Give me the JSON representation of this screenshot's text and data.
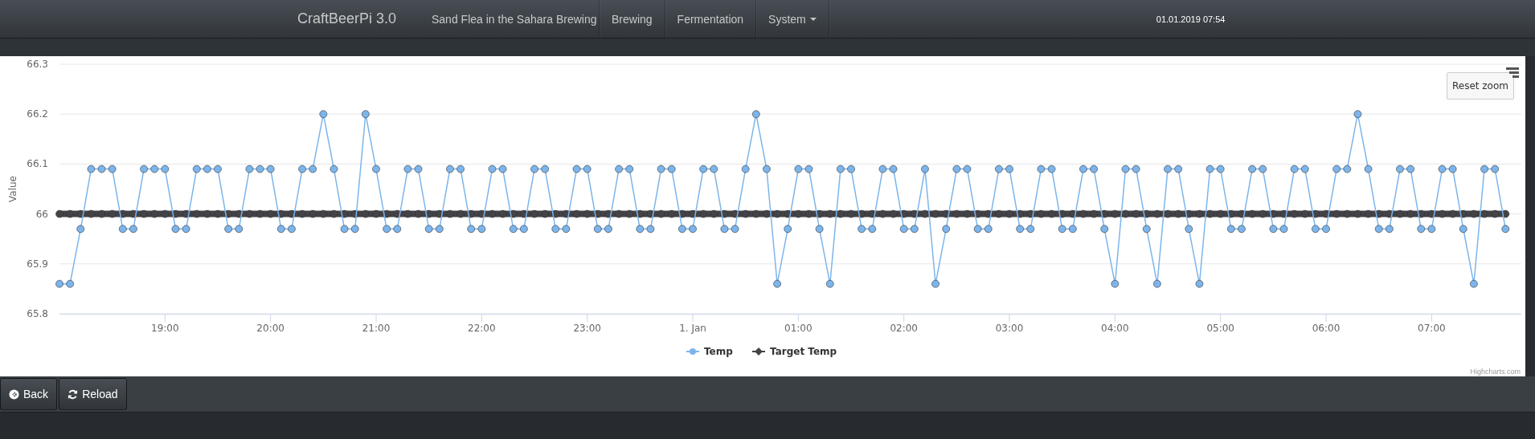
{
  "navbar": {
    "brand": "CraftBeerPi 3.0",
    "items": [
      {
        "label": "Sand Flea in the Sahara Brewing",
        "dropdown": false
      },
      {
        "label": "Brewing",
        "dropdown": false
      },
      {
        "label": "Fermentation",
        "dropdown": false
      },
      {
        "label": "System",
        "dropdown": true
      }
    ],
    "datetime": "01.01.2019 07:54"
  },
  "chart": {
    "reset_zoom": "Reset zoom",
    "credits": "Highcharts.com",
    "chart_data": {
      "type": "line",
      "ylabel": "Value",
      "grid": true,
      "legend": "bottom",
      "x": [
        "2018-12-31 18:00",
        "2018-12-31 18:06",
        "2018-12-31 18:12",
        "2018-12-31 18:18",
        "2018-12-31 18:24",
        "2018-12-31 18:30",
        "2018-12-31 18:36",
        "2018-12-31 18:42",
        "2018-12-31 18:48",
        "2018-12-31 18:54",
        "2018-12-31 19:00",
        "2018-12-31 19:06",
        "2018-12-31 19:12",
        "2018-12-31 19:18",
        "2018-12-31 19:24",
        "2018-12-31 19:30",
        "2018-12-31 19:36",
        "2018-12-31 19:42",
        "2018-12-31 19:48",
        "2018-12-31 19:54",
        "2018-12-31 20:00",
        "2018-12-31 20:06",
        "2018-12-31 20:12",
        "2018-12-31 20:18",
        "2018-12-31 20:24",
        "2018-12-31 20:30",
        "2018-12-31 20:36",
        "2018-12-31 20:42",
        "2018-12-31 20:48",
        "2018-12-31 20:54",
        "2018-12-31 21:00",
        "2018-12-31 21:06",
        "2018-12-31 21:12",
        "2018-12-31 21:18",
        "2018-12-31 21:24",
        "2018-12-31 21:30",
        "2018-12-31 21:36",
        "2018-12-31 21:42",
        "2018-12-31 21:48",
        "2018-12-31 21:54",
        "2018-12-31 22:00",
        "2018-12-31 22:06",
        "2018-12-31 22:12",
        "2018-12-31 22:18",
        "2018-12-31 22:24",
        "2018-12-31 22:30",
        "2018-12-31 22:36",
        "2018-12-31 22:42",
        "2018-12-31 22:48",
        "2018-12-31 22:54",
        "2018-12-31 23:00",
        "2018-12-31 23:06",
        "2018-12-31 23:12",
        "2018-12-31 23:18",
        "2018-12-31 23:24",
        "2018-12-31 23:30",
        "2018-12-31 23:36",
        "2018-12-31 23:42",
        "2018-12-31 23:48",
        "2018-12-31 23:54",
        "2019-01-01 00:00",
        "2019-01-01 00:06",
        "2019-01-01 00:12",
        "2019-01-01 00:18",
        "2019-01-01 00:24",
        "2019-01-01 00:30",
        "2019-01-01 00:36",
        "2019-01-01 00:42",
        "2019-01-01 00:48",
        "2019-01-01 00:54",
        "2019-01-01 01:00",
        "2019-01-01 01:06",
        "2019-01-01 01:12",
        "2019-01-01 01:18",
        "2019-01-01 01:24",
        "2019-01-01 01:30",
        "2019-01-01 01:36",
        "2019-01-01 01:42",
        "2019-01-01 01:48",
        "2019-01-01 01:54",
        "2019-01-01 02:00",
        "2019-01-01 02:06",
        "2019-01-01 02:12",
        "2019-01-01 02:18",
        "2019-01-01 02:24",
        "2019-01-01 02:30",
        "2019-01-01 02:36",
        "2019-01-01 02:42",
        "2019-01-01 02:48",
        "2019-01-01 02:54",
        "2019-01-01 03:00",
        "2019-01-01 03:06",
        "2019-01-01 03:12",
        "2019-01-01 03:18",
        "2019-01-01 03:24",
        "2019-01-01 03:30",
        "2019-01-01 03:36",
        "2019-01-01 03:42",
        "2019-01-01 03:48",
        "2019-01-01 03:54",
        "2019-01-01 04:00",
        "2019-01-01 04:06",
        "2019-01-01 04:12",
        "2019-01-01 04:18",
        "2019-01-01 04:24",
        "2019-01-01 04:30",
        "2019-01-01 04:36",
        "2019-01-01 04:42",
        "2019-01-01 04:48",
        "2019-01-01 04:54",
        "2019-01-01 05:00",
        "2019-01-01 05:06",
        "2019-01-01 05:12",
        "2019-01-01 05:18",
        "2019-01-01 05:24",
        "2019-01-01 05:30",
        "2019-01-01 05:36",
        "2019-01-01 05:42",
        "2019-01-01 05:48",
        "2019-01-01 05:54",
        "2019-01-01 06:00",
        "2019-01-01 06:06",
        "2019-01-01 06:12",
        "2019-01-01 06:18",
        "2019-01-01 06:24",
        "2019-01-01 06:30",
        "2019-01-01 06:36",
        "2019-01-01 06:42",
        "2019-01-01 06:48",
        "2019-01-01 06:54",
        "2019-01-01 07:00",
        "2019-01-01 07:06",
        "2019-01-01 07:12",
        "2019-01-01 07:18",
        "2019-01-01 07:24",
        "2019-01-01 07:30",
        "2019-01-01 07:36",
        "2019-01-01 07:42"
      ],
      "series": [
        {
          "name": "Temp",
          "color": "#7cb5ec",
          "marker": true,
          "values": [
            65.86,
            65.86,
            65.97,
            66.09,
            66.09,
            66.09,
            65.97,
            65.97,
            66.09,
            66.09,
            66.09,
            65.97,
            65.97,
            66.09,
            66.09,
            66.09,
            65.97,
            65.97,
            66.09,
            66.09,
            66.09,
            65.97,
            65.97,
            66.09,
            66.09,
            66.2,
            66.09,
            65.97,
            65.97,
            66.2,
            66.09,
            65.97,
            65.97,
            66.09,
            66.09,
            65.97,
            65.97,
            66.09,
            66.09,
            65.97,
            65.97,
            66.09,
            66.09,
            65.97,
            65.97,
            66.09,
            66.09,
            65.97,
            65.97,
            66.09,
            66.09,
            65.97,
            65.97,
            66.09,
            66.09,
            65.97,
            65.97,
            66.09,
            66.09,
            65.97,
            65.97,
            66.09,
            66.09,
            65.97,
            65.97,
            66.09,
            66.2,
            66.09,
            65.86,
            65.97,
            66.09,
            66.09,
            65.97,
            65.86,
            66.09,
            66.09,
            65.97,
            65.97,
            66.09,
            66.09,
            65.97,
            65.97,
            66.09,
            65.86,
            65.97,
            66.09,
            66.09,
            65.97,
            65.97,
            66.09,
            66.09,
            65.97,
            65.97,
            66.09,
            66.09,
            65.97,
            65.97,
            66.09,
            66.09,
            65.97,
            65.86,
            66.09,
            66.09,
            65.97,
            65.86,
            66.09,
            66.09,
            65.97,
            65.86,
            66.09,
            66.09,
            65.97,
            65.97,
            66.09,
            66.09,
            65.97,
            65.97,
            66.09,
            66.09,
            65.97,
            65.97,
            66.09,
            66.09,
            66.2,
            66.09,
            65.97,
            65.97,
            66.09,
            66.09,
            65.97,
            65.97,
            66.09,
            66.09,
            65.97,
            65.86,
            66.09,
            66.09,
            65.97
          ]
        },
        {
          "name": "Target Temp",
          "color": "#434348",
          "marker": true,
          "values": [
            66,
            66,
            66,
            66,
            66,
            66,
            66,
            66,
            66,
            66,
            66,
            66,
            66,
            66,
            66,
            66,
            66,
            66,
            66,
            66,
            66,
            66,
            66,
            66,
            66,
            66,
            66,
            66,
            66,
            66,
            66,
            66,
            66,
            66,
            66,
            66,
            66,
            66,
            66,
            66,
            66,
            66,
            66,
            66,
            66,
            66,
            66,
            66,
            66,
            66,
            66,
            66,
            66,
            66,
            66,
            66,
            66,
            66,
            66,
            66,
            66,
            66,
            66,
            66,
            66,
            66,
            66,
            66,
            66,
            66,
            66,
            66,
            66,
            66,
            66,
            66,
            66,
            66,
            66,
            66,
            66,
            66,
            66,
            66,
            66,
            66,
            66,
            66,
            66,
            66,
            66,
            66,
            66,
            66,
            66,
            66,
            66,
            66,
            66,
            66,
            66,
            66,
            66,
            66,
            66,
            66,
            66,
            66,
            66,
            66,
            66,
            66,
            66,
            66,
            66,
            66,
            66,
            66,
            66,
            66,
            66,
            66,
            66,
            66,
            66,
            66,
            66,
            66,
            66,
            66,
            66,
            66,
            66,
            66,
            66,
            66,
            66,
            66
          ]
        }
      ],
      "xlim": [
        "2018-12-31 18:00",
        "2019-01-01 07:51"
      ],
      "ylim": [
        65.8,
        66.3
      ],
      "xticks": [
        {
          "value": "2018-12-31 19:00",
          "label": "19:00"
        },
        {
          "value": "2018-12-31 20:00",
          "label": "20:00"
        },
        {
          "value": "2018-12-31 21:00",
          "label": "21:00"
        },
        {
          "value": "2018-12-31 22:00",
          "label": "22:00"
        },
        {
          "value": "2018-12-31 23:00",
          "label": "23:00"
        },
        {
          "value": "2019-01-01 00:00",
          "label": "1. Jan"
        },
        {
          "value": "2019-01-01 01:00",
          "label": "01:00"
        },
        {
          "value": "2019-01-01 02:00",
          "label": "02:00"
        },
        {
          "value": "2019-01-01 03:00",
          "label": "03:00"
        },
        {
          "value": "2019-01-01 04:00",
          "label": "04:00"
        },
        {
          "value": "2019-01-01 05:00",
          "label": "05:00"
        },
        {
          "value": "2019-01-01 06:00",
          "label": "06:00"
        },
        {
          "value": "2019-01-01 07:00",
          "label": "07:00"
        }
      ],
      "yticks": [
        65.8,
        65.9,
        66,
        66.1,
        66.2,
        66.3
      ]
    }
  },
  "buttons": [
    {
      "label": "Back",
      "kind": "back"
    },
    {
      "label": "Reload",
      "kind": "reload"
    }
  ]
}
